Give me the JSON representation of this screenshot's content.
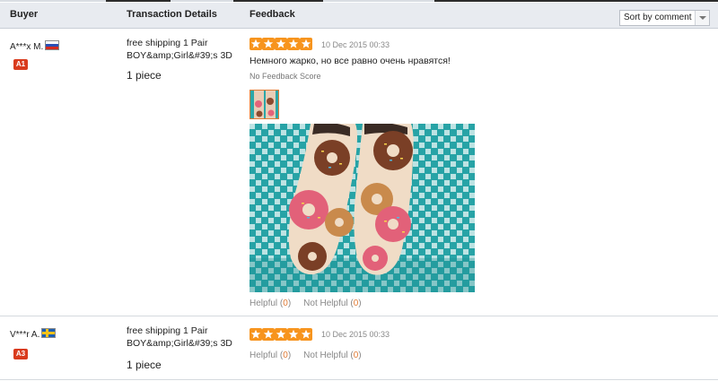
{
  "header": {
    "buyer": "Buyer",
    "transaction": "Transaction Details",
    "feedback": "Feedback",
    "sort_label": "Sort by comment"
  },
  "colors": {
    "header_bg": "#e8ebf0",
    "star": "#f7941d",
    "level_badge": "#d93b1d",
    "count": "#e07b35"
  },
  "reviews": [
    {
      "buyer": "A***x M.",
      "flag": "flag-russia-icon",
      "level": "A1",
      "product": "free shipping 1 Pair BOY&amp;Girl&#39;s 3D",
      "quantity": "1 piece",
      "stars": 5,
      "date": "10 Dec 2015 00:33",
      "comment": "Немного жарко, но все равно очень нравятся!",
      "score": "No Feedback Score",
      "helpful_label": "Helpful (",
      "helpful_count": "0",
      "not_helpful_label": "Not Helpful (",
      "not_helpful_count": "0",
      "close": ")"
    },
    {
      "buyer": "V***r A.",
      "flag": "flag-sweden-icon",
      "level": "A3",
      "product": "free shipping 1 Pair BOY&amp;Girl&#39;s 3D",
      "quantity": "1 piece",
      "stars": 5,
      "date": "10 Dec 2015 00:33",
      "helpful_label": "Helpful (",
      "helpful_count": "0",
      "not_helpful_label": "Not Helpful (",
      "not_helpful_count": "0",
      "close": ")"
    }
  ]
}
